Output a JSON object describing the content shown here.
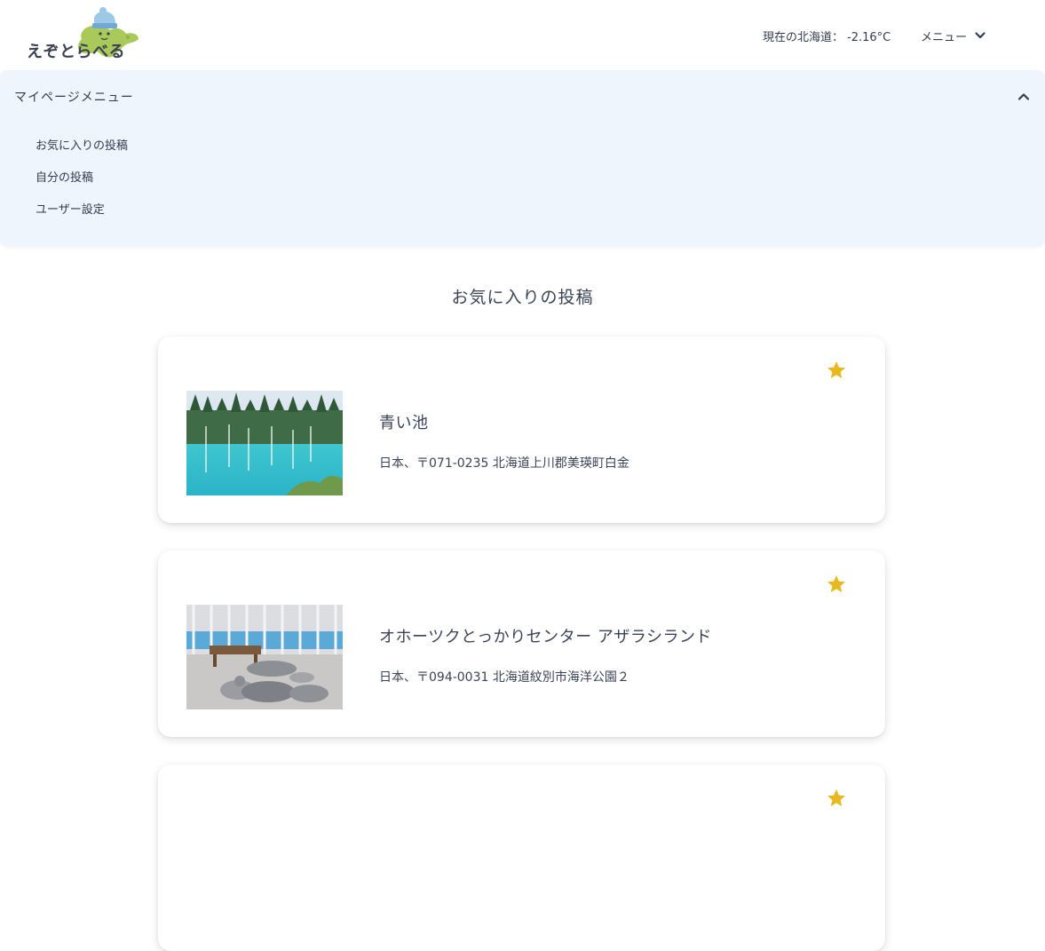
{
  "header": {
    "logo_text": "えぞとらべる",
    "temperature_label": "現在の北海道：",
    "temperature_value": "-2.16°C",
    "menu_label": "メニュー"
  },
  "mypage_menu": {
    "title": "マイページメニュー",
    "items": [
      {
        "label": "お気に入りの投稿"
      },
      {
        "label": "自分の投稿"
      },
      {
        "label": "ユーザー設定"
      }
    ]
  },
  "main": {
    "section_title": "お気に入りの投稿",
    "posts": [
      {
        "name": "青い池",
        "address": "日本、〒071-0235 北海道上川郡美瑛町白金"
      },
      {
        "name": "オホーツクとっかりセンター アザラシランド",
        "address": "日本、〒094-0031 北海道紋別市海洋公園２"
      }
    ]
  },
  "colors": {
    "accent_star": "#e8b81f",
    "mypage_bg": "#eef5fd",
    "text": "#333b4f"
  }
}
